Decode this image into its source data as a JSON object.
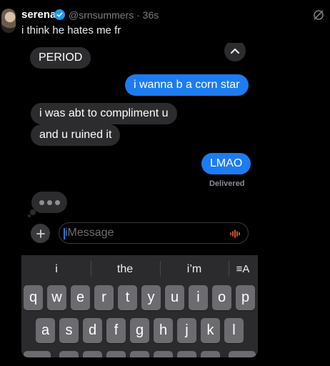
{
  "tweet": {
    "author_name": "serena",
    "handle_time": "@srnsummers · 36s",
    "text": "i think he hates me fr"
  },
  "conversation": {
    "messages": [
      {
        "from": "them",
        "text": "PERIOD"
      },
      {
        "from": "me",
        "text": "i wanna b a corn star"
      },
      {
        "from": "them",
        "text": "i was abt to compliment u"
      },
      {
        "from": "them",
        "text": "and u ruined it"
      },
      {
        "from": "me",
        "text": "LMAO"
      }
    ],
    "status": "Delivered"
  },
  "compose": {
    "placeholder": "iMessage"
  },
  "keyboard": {
    "suggestions": [
      "i",
      "the",
      "i’m"
    ],
    "format_label": "≡A",
    "row1": [
      "q",
      "w",
      "e",
      "r",
      "t",
      "y",
      "u",
      "i",
      "o",
      "p"
    ],
    "row2": [
      "a",
      "s",
      "d",
      "f",
      "g",
      "h",
      "j",
      "k",
      "l"
    ]
  },
  "colors": {
    "sent_bubble": "#1d7cf2",
    "received_bubble": "#2c2c2e",
    "verified_badge": "#1d9bf0"
  },
  "icons": [
    "verified-badge-icon",
    "more-icon",
    "chevron-up-icon",
    "plus-icon",
    "audio-waveform-icon"
  ]
}
